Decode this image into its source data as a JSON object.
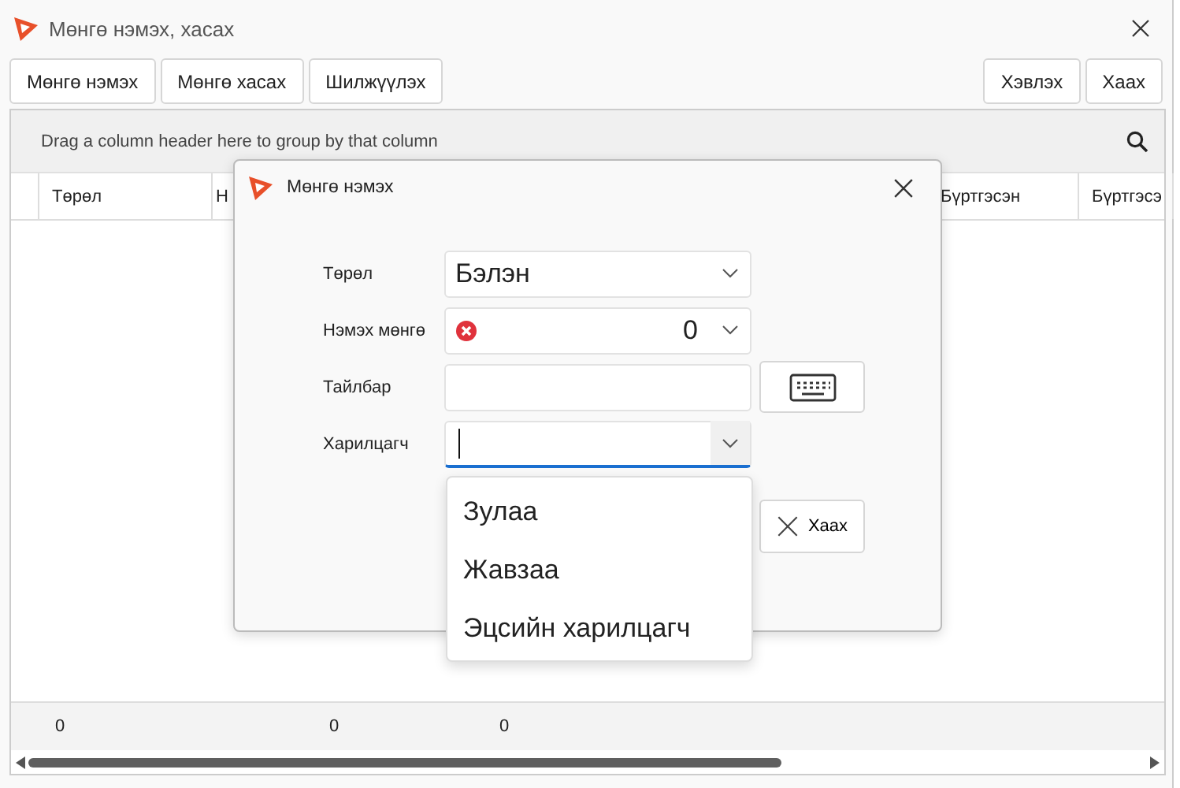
{
  "window": {
    "title": "Мөнгө нэмэх, хасах"
  },
  "toolbar": {
    "left_buttons": [
      "Мөнгө нэмэх",
      "Мөнгө хасах",
      "Шилжүүлэх"
    ],
    "right_buttons": [
      "Хэвлэх",
      "Хаах"
    ]
  },
  "grid": {
    "group_hint": "Drag a column header here to group by that column",
    "columns": [
      "Төрөл",
      "Н",
      "Бүртгэсэн",
      "Бүртгэсэ"
    ],
    "totals": [
      "0",
      "0",
      "0"
    ]
  },
  "dialog": {
    "title": "Мөнгө нэмэх",
    "fields": [
      {
        "label": "Төрөл",
        "kind": "combo",
        "value": "Бэлэн",
        "error": false,
        "focused": false
      },
      {
        "label": "Нэмэх мөнгө",
        "kind": "number",
        "value": "0",
        "error": true,
        "focused": false
      },
      {
        "label": "Тайлбар",
        "kind": "text",
        "error": false,
        "focused": false
      },
      {
        "label": "Харилцагч",
        "kind": "combo",
        "error": false,
        "focused": true
      }
    ],
    "close_button": "Хаах",
    "dropdown": [
      {
        "label": "Зулаа",
        "selected": false
      },
      {
        "label": "Жавзаа",
        "selected": false
      },
      {
        "label": "Эцсийн харилцагч",
        "selected": false
      }
    ]
  }
}
